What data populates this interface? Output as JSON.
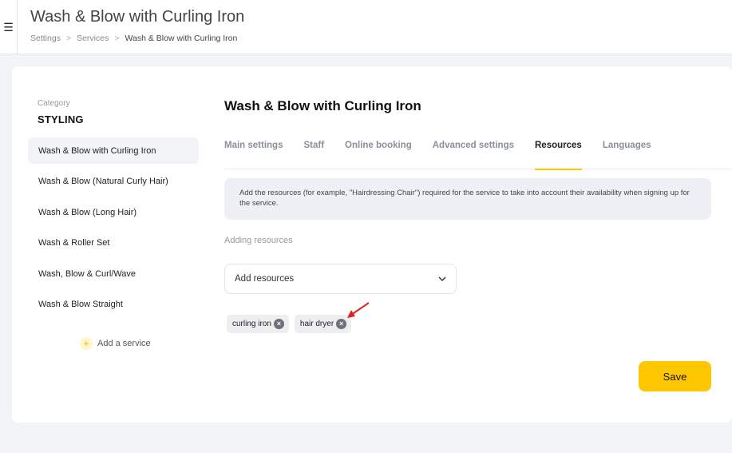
{
  "header": {
    "title": "Wash & Blow with Curling Iron",
    "menu_icon": "☰",
    "breadcrumb": [
      "Settings",
      "Services",
      "Wash & Blow with Curling Iron"
    ],
    "breadcrumb_sep": ">"
  },
  "sidebar": {
    "category_label": "Category",
    "category_name": "STYLING",
    "services": [
      "Wash & Blow with Curling Iron",
      "Wash & Blow (Natural Curly Hair)",
      "Wash & Blow (Long Hair)",
      "Wash & Roller Set",
      "Wash, Blow & Curl/Wave",
      "Wash & Blow Straight"
    ],
    "add_service_label": "Add a service",
    "add_icon": "+"
  },
  "main": {
    "title": "Wash & Blow with Curling Iron",
    "tabs": [
      "Main settings",
      "Staff",
      "Online booking",
      "Advanced settings",
      "Resources",
      "Languages"
    ],
    "active_tab": "Resources",
    "info_text": "Add the resources (for example, \"Hairdressing Chair\") required for the service to take into account their availability when signing up for the service.",
    "section_label": "Adding resources",
    "dropdown_placeholder": "Add resources",
    "dropdown_icon": "⌄",
    "chips": [
      "curling iron",
      "hair dryer"
    ],
    "chip_remove_icon": "×",
    "save_label": "Save"
  },
  "colors": {
    "accent": "#ffc700",
    "annotation_arrow": "#e41e1e"
  }
}
